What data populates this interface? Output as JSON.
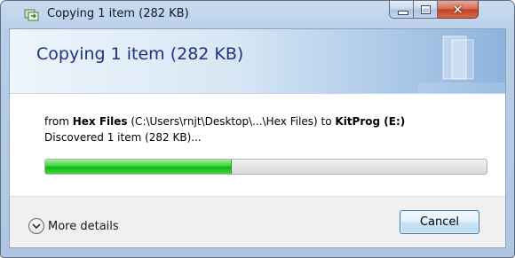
{
  "window": {
    "title": "Copying 1 item (282 KB)",
    "icons": {
      "app": "copy-icon",
      "minimize": "minimize-icon",
      "maximize": "maximize-icon",
      "close": "close-icon"
    }
  },
  "dialog": {
    "header": "Copying 1 item (282 KB)",
    "from_prefix": "from ",
    "source_name": "Hex Files",
    "source_path": " (C:\\Users\\rnjt\\Desktop\\...\\Hex Files)  to ",
    "dest_name": "KitProg (E:)",
    "status": "Discovered 1 item (282 KB)...",
    "progress_fraction": 0.42
  },
  "footer": {
    "more_details_label": "More details",
    "more_details_icon": "chevron-down-icon",
    "cancel_label": "Cancel"
  },
  "colors": {
    "header_text": "#1e3287",
    "progress_green": "#12b318"
  }
}
